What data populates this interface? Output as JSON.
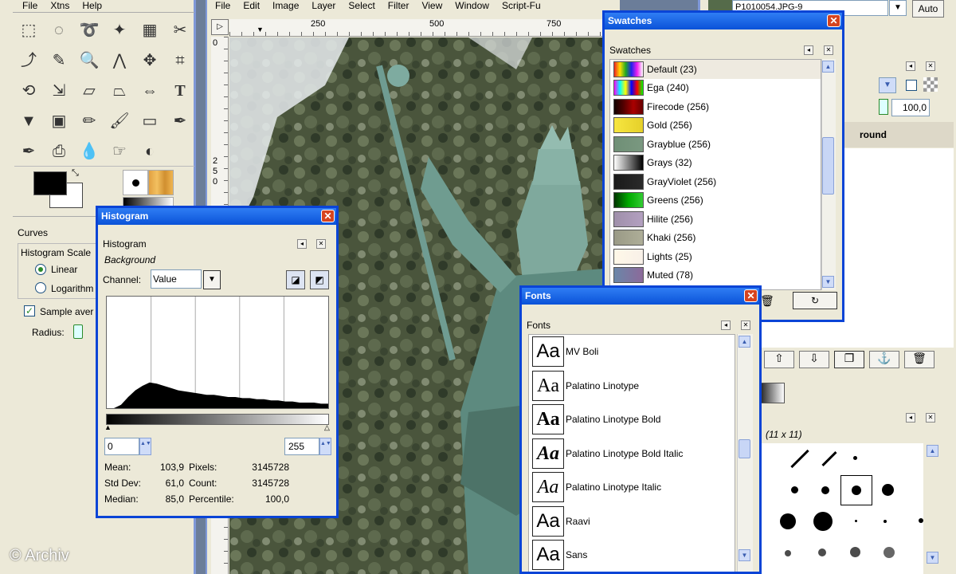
{
  "toolbox": {
    "menu": [
      "File",
      "Xtns",
      "Help"
    ],
    "tools": [
      "rect-select",
      "ellipse-select",
      "free-select",
      "fuzzy-select",
      "color-select",
      "scissors-select",
      "paths",
      "color-picker",
      "zoom",
      "measure",
      "move",
      "crop",
      "rotate",
      "scale",
      "shear",
      "perspective",
      "flip",
      "text",
      "bucket-fill",
      "blend",
      "pencil",
      "paintbrush",
      "eraser",
      "airbrush",
      "ink",
      "clone",
      "blur",
      "smudge",
      "dodge"
    ],
    "text_tool_glyph": "T",
    "options_title": "Curves",
    "hist_scale_label": "Histogram Scale",
    "opt_linear": "Linear",
    "opt_log": "Logarithm",
    "sample_label": "Sample aver",
    "radius_label": "Radius:"
  },
  "image_window": {
    "menu": [
      "File",
      "Edit",
      "Image",
      "Layer",
      "Select",
      "Filter",
      "View",
      "Window",
      "Script-Fu"
    ],
    "ruler_h": [
      "250",
      "500",
      "750"
    ],
    "ruler_v_top": "0",
    "ruler_v_mid": [
      "2",
      "5",
      "0"
    ]
  },
  "histogram": {
    "title": "Histogram",
    "panel_title": "Histogram",
    "layer": "Background",
    "channel_label": "Channel:",
    "channel_value": "Value",
    "range_min": "0",
    "range_max": "255",
    "stats": [
      {
        "label": "Mean:",
        "value": "103,9"
      },
      {
        "label": "Std Dev:",
        "value": "61,0"
      },
      {
        "label": "Median:",
        "value": "85,0"
      }
    ],
    "stats2": [
      {
        "label": "Pixels:",
        "value": "3145728"
      },
      {
        "label": "Count:",
        "value": "3145728"
      },
      {
        "label": "Percentile:",
        "value": "100,0"
      }
    ],
    "curve": [
      0,
      0,
      0.03,
      0.1,
      0.16,
      0.2,
      0.23,
      0.22,
      0.2,
      0.18,
      0.16,
      0.15,
      0.14,
      0.13,
      0.12,
      0.12,
      0.11,
      0.1,
      0.1,
      0.09,
      0.09,
      0.08,
      0.08,
      0.07,
      0.07,
      0.06,
      0.06,
      0.05,
      0.05,
      0.05,
      0.04,
      0.04
    ]
  },
  "swatches": {
    "title": "Swatches",
    "panel_title": "Swatches",
    "items": [
      {
        "label": "Default (23)",
        "colors": [
          "#e22",
          "#fd0",
          "#2a2",
          "#22e",
          "#e2e",
          "#fff"
        ]
      },
      {
        "label": "Ega (240)",
        "colors": [
          "#f0f",
          "#0ff",
          "#ff0",
          "#00f",
          "#f00",
          "#0f0"
        ]
      },
      {
        "label": "Firecode (256)",
        "colors": [
          "#100",
          "#500",
          "#a00",
          "#600"
        ]
      },
      {
        "label": "Gold (256)",
        "colors": [
          "#f7e640",
          "#e5d02a"
        ]
      },
      {
        "label": "Grayblue (256)",
        "colors": [
          "#6f8f76",
          "#7a9880"
        ]
      },
      {
        "label": "Grays (32)",
        "colors": [
          "#fff",
          "#000"
        ]
      },
      {
        "label": "GrayViolet (256)",
        "colors": [
          "#1a1a1a",
          "#2b2b2b"
        ]
      },
      {
        "label": "Greens (256)",
        "colors": [
          "#030",
          "#0a0",
          "#3c3"
        ]
      },
      {
        "label": "Hilite (256)",
        "colors": [
          "#9f8faa",
          "#b3a0c0"
        ]
      },
      {
        "label": "Khaki (256)",
        "colors": [
          "#9a9a86",
          "#aeae98"
        ]
      },
      {
        "label": "Lights (25)",
        "colors": [
          "#fff8e8",
          "#f8f0e8"
        ]
      },
      {
        "label": "Muted (78)",
        "colors": [
          "#6a86a8",
          "#8c6a9a"
        ]
      }
    ]
  },
  "fonts": {
    "title": "Fonts",
    "panel_title": "Fonts",
    "items": [
      {
        "label": "MV Boli",
        "preview": "Aa",
        "style": "normal"
      },
      {
        "label": "Palatino Linotype",
        "preview": "Aa",
        "style": "serif"
      },
      {
        "label": "Palatino Linotype Bold",
        "preview": "Aa",
        "style": "bold"
      },
      {
        "label": "Palatino Linotype Bold Italic",
        "preview": "Aa",
        "style": "bolditalic"
      },
      {
        "label": "Palatino Linotype Italic",
        "preview": "Aa",
        "style": "italic"
      },
      {
        "label": "Raavi",
        "preview": "Aa",
        "style": "normal"
      },
      {
        "label": "Sans",
        "preview": "Aa",
        "style": "normal"
      }
    ]
  },
  "layers_dock": {
    "image_name": "P1010054.JPG-9",
    "auto_label": "Auto",
    "opacity": "100,0",
    "layer_name_partial": "round",
    "brush_size": "(11 x 11)"
  },
  "watermark": "© Archiv",
  "colors": {
    "xp_blue": "#0a44d6",
    "panel_bg": "#ece9d8"
  }
}
